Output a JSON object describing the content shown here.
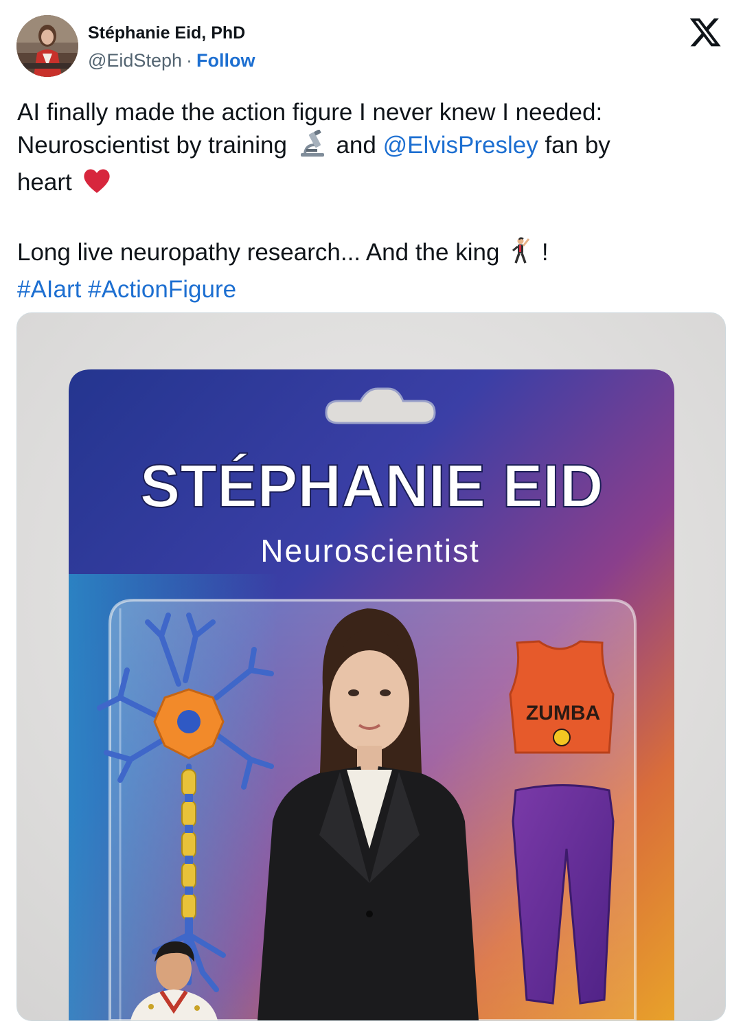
{
  "author": {
    "display_name": "Stéphanie Eid, PhD",
    "handle": "@EidSteph",
    "separator": "·",
    "follow_label": "Follow",
    "avatar_icon": "profile-photo"
  },
  "brand": {
    "logo_icon": "x-logo"
  },
  "tweet": {
    "line1": "AI finally made the action figure I never knew I needed:",
    "line2_start": "Neuroscientist by training",
    "line2_mid": "and",
    "mention": "@ElvisPresley",
    "line2_end": "fan by",
    "line3": "heart",
    "line4": "Long live neuropathy research... And the king",
    "line4_end": "!",
    "hashtag1": "#AIart",
    "hashtag2": "#ActionFigure",
    "emoji_1": "microscope-icon",
    "emoji_2": "heart-icon",
    "emoji_3": "dancer-icon"
  },
  "media": {
    "package_name": "STÉPHANIE EID",
    "package_subtitle": "Neuroscientist",
    "top_label": "ZUMBA",
    "colors": {
      "accent_link": "#1d6fd1",
      "heart": "#d7263d",
      "card_blue": "#2c3a9e",
      "card_orange": "#e6941f"
    }
  }
}
